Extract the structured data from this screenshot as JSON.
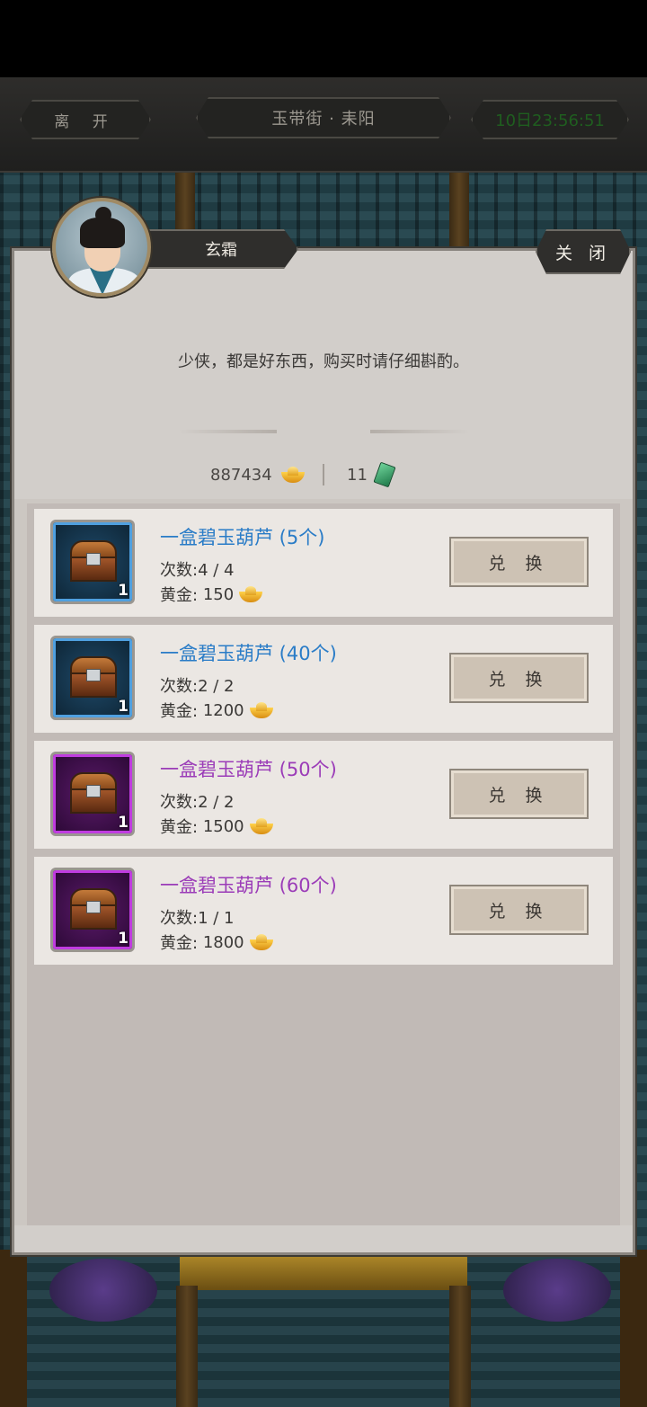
{
  "header": {
    "leave_label": "离 开",
    "location": "玉带街 · 耒阳",
    "timer": "10日23:56:51"
  },
  "npc": {
    "name": "玄霜",
    "dialog": "少侠，都是好东西，购买时请仔细斟酌。"
  },
  "close_label": "关 闭",
  "currency": {
    "gold": "887434",
    "jade": "11"
  },
  "items": [
    {
      "name": "一盒碧玉葫芦 (5个)",
      "count": "次数:4 / 4",
      "price_label": "黄金:",
      "price": "150",
      "qty": "1",
      "rarity": "blue",
      "button": "兑 换"
    },
    {
      "name": "一盒碧玉葫芦 (40个)",
      "count": "次数:2 / 2",
      "price_label": "黄金:",
      "price": "1200",
      "qty": "1",
      "rarity": "blue",
      "button": "兑 换"
    },
    {
      "name": "一盒碧玉葫芦 (50个)",
      "count": "次数:2 / 2",
      "price_label": "黄金:",
      "price": "1500",
      "qty": "1",
      "rarity": "purple",
      "button": "兑 换"
    },
    {
      "name": "一盒碧玉葫芦 (60个)",
      "count": "次数:1 / 1",
      "price_label": "黄金:",
      "price": "1800",
      "qty": "1",
      "rarity": "purple",
      "button": "兑 换"
    }
  ],
  "colors": {
    "blue_rarity": "#2a7cc7",
    "purple_rarity": "#9b3cb8",
    "timer": "#1f5e1f"
  }
}
